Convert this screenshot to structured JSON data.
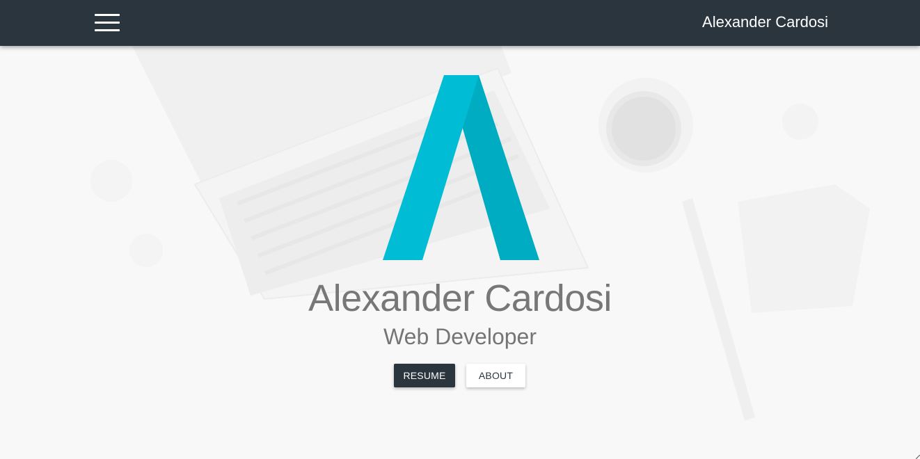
{
  "navbar": {
    "menu_icon": "hamburger-menu-icon",
    "brand": "Alexander Cardosi"
  },
  "hero": {
    "logo_icon": "a-letter-logo-icon",
    "title": "Alexander Cardosi",
    "subtitle": "Web Developer",
    "buttons": {
      "resume_label": "RESUME",
      "about_label": "ABOUT"
    }
  },
  "colors": {
    "navbar_bg": "#2b353d",
    "accent": "#00bcd4",
    "accent_dark": "#00acc1",
    "text_muted": "#777777"
  }
}
